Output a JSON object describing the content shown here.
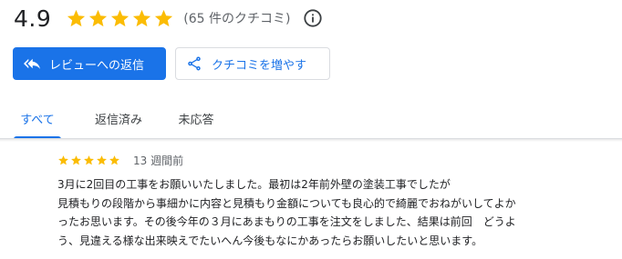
{
  "summary": {
    "rating": "4.9",
    "stars": 5,
    "review_count_label": "(65 件のクチコミ)",
    "info_icon": "info-icon"
  },
  "actions": {
    "reply_label": "レビューへの返信",
    "share_label": "クチコミを増やす"
  },
  "tabs": [
    {
      "label": "すべて",
      "active": true
    },
    {
      "label": "返信済み",
      "active": false
    },
    {
      "label": "未応答",
      "active": false
    }
  ],
  "review": {
    "stars": 5,
    "date": "13 週間前",
    "text": "3月に2回目の工事をお願いいたしました。最初は2年前外壁の塗装工事でしたが\n見積もりの段階から事細かに内容と見積もり金額についても良心的で綺麗でおねがいしてよか\nったお思います。その後今年の３月にあまもりの工事を注文をしました、結果は前回　どうよ\nう、見違える様な出来映えでたいへん今後もなにかあったらお願いしたいと思います。"
  },
  "colors": {
    "accent": "#1a73e8",
    "star": "#fbbc04",
    "text": "#202124",
    "muted": "#5f6368"
  }
}
